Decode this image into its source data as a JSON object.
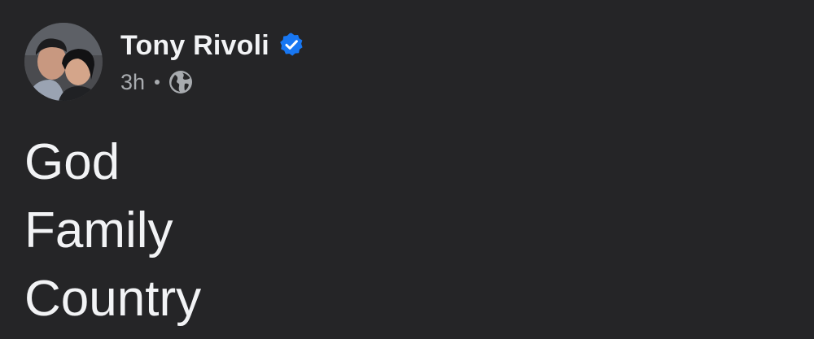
{
  "post": {
    "author": {
      "name": "Tony Rivoli",
      "avatar_icon": "profile-photo",
      "verified": true,
      "verified_icon": "verified-badge-icon",
      "verified_color": "#1877f2"
    },
    "timestamp": "3h",
    "audience_icon": "globe-icon",
    "body_lines": [
      "God",
      "Family",
      "Country"
    ]
  },
  "colors": {
    "background": "#252527",
    "primary_text": "#f2f3f5",
    "secondary_text": "#a8abaf"
  }
}
